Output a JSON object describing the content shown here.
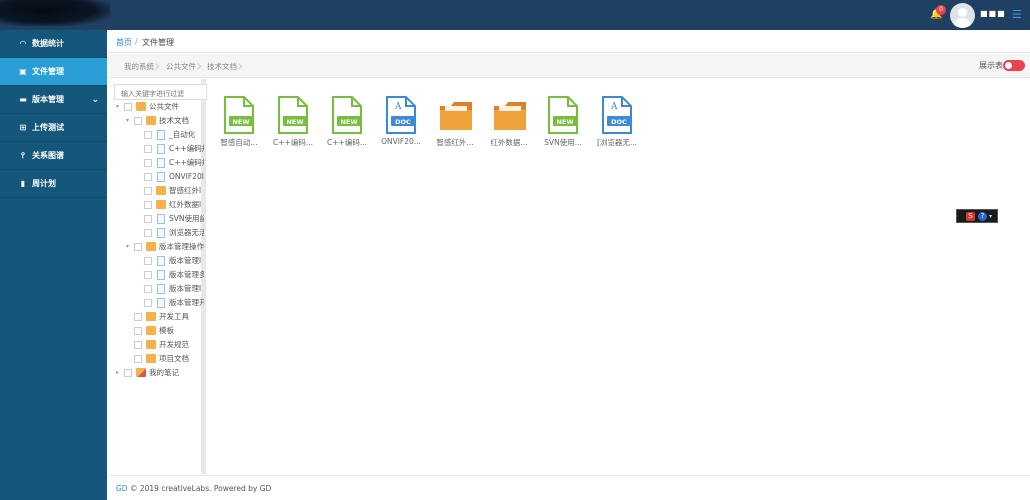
{
  "header": {
    "notification_count": "0",
    "username": "■■■",
    "menu_icon": "hamburger-icon",
    "colors": {
      "topbar": "#1f3f63",
      "badge": "#e9434b",
      "accent": "#3aa0e8"
    }
  },
  "sidebar": {
    "items": [
      {
        "label": "数据统计",
        "icon": "dashboard-icon",
        "active": false
      },
      {
        "label": "文件管理",
        "icon": "file-icon",
        "active": true
      },
      {
        "label": "版本管理",
        "icon": "version-icon",
        "active": false,
        "expandable": true
      },
      {
        "label": "上传测试",
        "icon": "upload-icon",
        "active": false
      },
      {
        "label": "关系图谱",
        "icon": "graph-icon",
        "active": false
      },
      {
        "label": "周计划",
        "icon": "chart-icon",
        "active": false
      }
    ],
    "colors": {
      "background": "#15577a",
      "active": "#2a9fd6"
    }
  },
  "breadcrumb": {
    "home": "首页",
    "separator": "/",
    "current": "文件管理"
  },
  "path": {
    "segments": [
      "我的系统",
      "公共文件",
      "技术文档"
    ]
  },
  "view_toggle": {
    "label": "展示表",
    "on": true
  },
  "tree": {
    "search_placeholder": "输入关键字进行过滤",
    "nodes": [
      {
        "label": "公共文件",
        "type": "folder"
      },
      {
        "label": "技术文档",
        "type": "folder"
      },
      {
        "label": "_自动化",
        "type": "file"
      },
      {
        "label": "C++编码规",
        "type": "file"
      },
      {
        "label": "C++编码规",
        "type": "file"
      },
      {
        "label": "ONVIF20l",
        "type": "file"
      },
      {
        "label": "智感红外l",
        "type": "folder"
      },
      {
        "label": "红外数据l",
        "type": "folder"
      },
      {
        "label": "SVN使用記",
        "type": "file"
      },
      {
        "label": "浏览器无活",
        "type": "file"
      },
      {
        "label": "版本管理操作",
        "type": "folder"
      },
      {
        "label": "版本管理l",
        "type": "file"
      },
      {
        "label": "版本管理多",
        "type": "file"
      },
      {
        "label": "版本管理l",
        "type": "file"
      },
      {
        "label": "版本管理开",
        "type": "file"
      },
      {
        "label": "开发工具",
        "type": "folder"
      },
      {
        "label": "模板",
        "type": "folder"
      },
      {
        "label": "开发规范",
        "type": "folder"
      },
      {
        "label": "项目文档",
        "type": "folder"
      },
      {
        "label": "我的笔记",
        "type": "note"
      }
    ]
  },
  "files": [
    {
      "name": "智感自动...",
      "icon": "new-doc-icon",
      "badge": "NEW"
    },
    {
      "name": "C++编码...",
      "icon": "new-doc-icon",
      "badge": "NEW"
    },
    {
      "name": "C++编码...",
      "icon": "new-doc-icon",
      "badge": "NEW"
    },
    {
      "name": "ONVIF20...",
      "icon": "word-doc-icon",
      "badge": "DOC"
    },
    {
      "name": "智感红外...",
      "icon": "folder-icon",
      "badge": ""
    },
    {
      "name": "红外数据...",
      "icon": "folder-icon",
      "badge": ""
    },
    {
      "name": "SVN使用...",
      "icon": "new-doc-icon",
      "badge": "NEW"
    },
    {
      "name": "[浏览器无...",
      "icon": "word-doc-icon",
      "badge": "DOC"
    }
  ],
  "floating_widget": {
    "s_label": "S",
    "help_label": "?",
    "dropdown_label": "▾"
  },
  "footer": {
    "brand": "GD",
    "text": " © 2019 creativeLabs. Powered by GD"
  }
}
